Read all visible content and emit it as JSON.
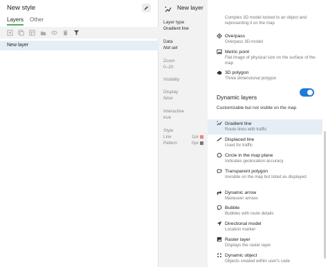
{
  "left_panel": {
    "title": "New style",
    "tabs": [
      "Layers",
      "Other"
    ],
    "layers": [
      "New layer"
    ]
  },
  "header": {
    "title": "New layer"
  },
  "properties": {
    "layer_type_label": "Layer type",
    "layer_type_value": "Gradient line",
    "data_label": "Data",
    "data_value": "Not set",
    "zoom_label": "Zoom",
    "zoom_value": "0–20",
    "visibility_label": "Visibility",
    "display_label": "Display",
    "display_value": "false",
    "interactive_label": "Interactive",
    "interactive_value": "true",
    "style_label": "Style",
    "style_line_label": "Line",
    "style_line_value": "1px",
    "style_pattern_label": "Pattern",
    "style_pattern_value": "0px",
    "line_color": "#f08080",
    "pattern_color": "#777777"
  },
  "layer_list": {
    "top_items": [
      {
        "title": "",
        "desc": "Complex 3D model locked to an object and representing it on the map"
      },
      {
        "title": "Overpass",
        "desc": "Overpass 3D-model"
      },
      {
        "title": "Metric point",
        "desc": "Flat image of physical size on the surface of the map"
      },
      {
        "title": "3D polygon",
        "desc": "Three dimensional polygon"
      }
    ],
    "dynamic_section_title": "Dynamic layers",
    "dynamic_section_desc": "Customizable but not visible on the map",
    "dynamic_toggle_on": true,
    "dynamic_items": [
      {
        "title": "Gradient line",
        "desc": "Route lines with traffic",
        "icon": "gradient-line-icon"
      },
      {
        "title": "Displaced line",
        "desc": "Used for traffic",
        "icon": "displaced-line-icon"
      },
      {
        "title": "Circle in the map plane",
        "desc": "Indicates geolocation accuracy",
        "icon": "circle-icon"
      },
      {
        "title": "Transparent polygon",
        "desc": "Invisible on the map but listed as displayed",
        "icon": "transparent-polygon-icon"
      },
      {
        "title": "Dynamic arrow",
        "desc": "Maneuver arrows",
        "icon": "arrow-icon"
      },
      {
        "title": "Bubble",
        "desc": "Bubbles with route details",
        "icon": "bubble-icon"
      },
      {
        "title": "Directional model",
        "desc": "Location marker",
        "icon": "location-marker-icon"
      },
      {
        "title": "Raster layer",
        "desc": "Displays the raster layer",
        "icon": "raster-icon"
      },
      {
        "title": "Dynamic object",
        "desc": "Objects created within user's code",
        "icon": "dynamic-object-icon"
      }
    ]
  },
  "colors": {
    "accent": "#1f7ad6",
    "tab_underline": "#4caf50",
    "selection": "#e5eef6"
  }
}
